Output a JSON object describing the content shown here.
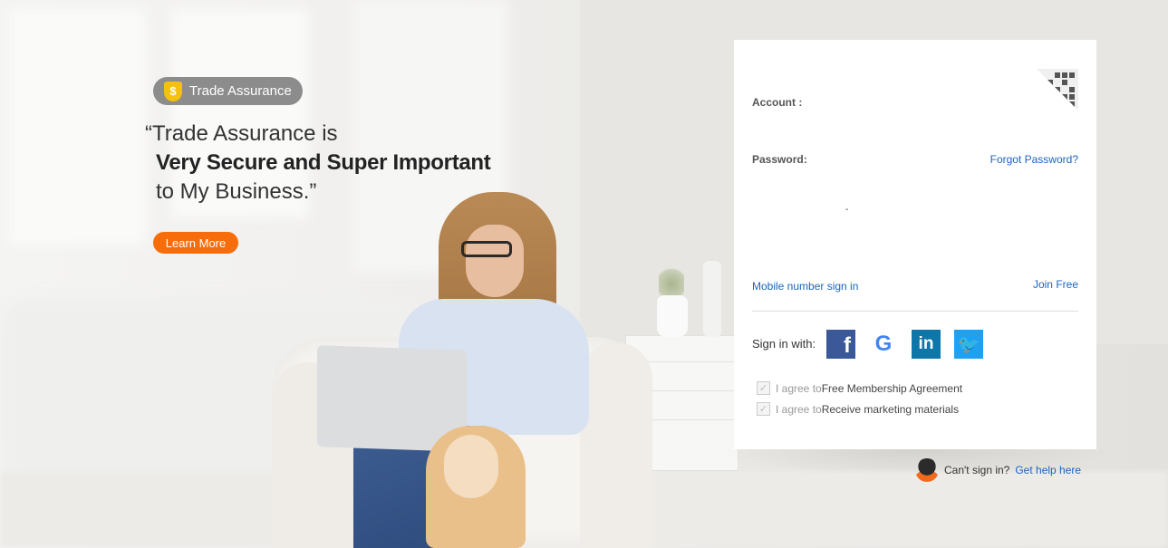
{
  "promo": {
    "badge_label": "Trade Assurance",
    "quote_line1": "“Trade Assurance is",
    "quote_line2": "Very Secure and Super Important",
    "quote_line3": "to My Business.”",
    "learn_more_label": "Learn More"
  },
  "login": {
    "account_label": "Account :",
    "password_label": "Password:",
    "forgot_password_label": "Forgot Password?",
    "mobile_signin_label": "Mobile number sign in",
    "join_free_label": "Join Free",
    "password_value": "-",
    "signin_with_label": "Sign in with:",
    "social": {
      "facebook_glyph": "f",
      "google_glyph": "G",
      "linkedin_glyph": "in",
      "twitter_glyph": "🐦"
    },
    "agreements": [
      {
        "prefix": "I agree to ",
        "link": "Free Membership Agreement"
      },
      {
        "prefix": "I agree to ",
        "link": "Receive marketing materials"
      }
    ]
  },
  "help": {
    "prompt": "Can't sign in?",
    "link": "Get help here"
  },
  "icons": {
    "trade_assurance": "shield-dollar-icon",
    "qr": "qr-code-icon",
    "support": "support-agent-icon"
  },
  "colors": {
    "accent_orange": "#f76d0b",
    "link_blue": "#1a65c0",
    "facebook": "#3b5998",
    "linkedin": "#0e76a8",
    "twitter": "#1da1f2",
    "badge_gray": "#8c8c8c"
  }
}
